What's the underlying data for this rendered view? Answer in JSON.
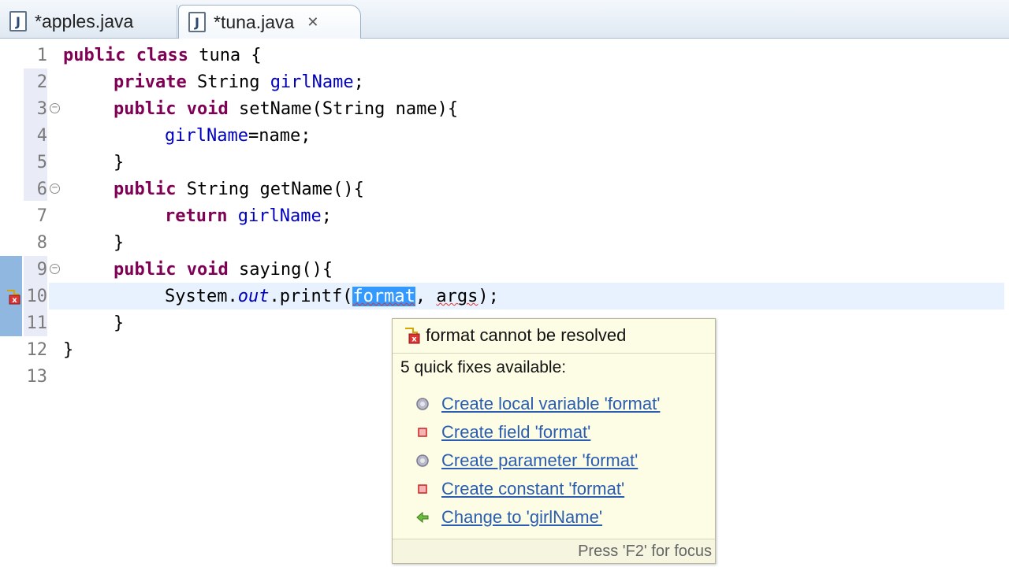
{
  "tabs": [
    {
      "label": "*apples.java",
      "icon": "java-file-icon",
      "active": false
    },
    {
      "label": "*tuna.java",
      "icon": "java-file-icon",
      "active": true,
      "close": "✕"
    }
  ],
  "editor": {
    "line_numbers": [
      "1",
      "2",
      "3",
      "4",
      "5",
      "6",
      "7",
      "8",
      "9",
      "10",
      "11",
      "12",
      "13"
    ],
    "lines": {
      "l1": {
        "kw": "public class",
        "rest": " tuna {"
      },
      "l2": {
        "kw": "private",
        "type": " String ",
        "field": "girlName",
        "end": ";"
      },
      "l3": {
        "kw": "public void",
        "rest": " setName(String name){"
      },
      "l4": {
        "field": "girlName",
        "rest": "=name;"
      },
      "l5": {
        "rest": "}"
      },
      "l6": {
        "kw": "public",
        "rest": " String getName(){"
      },
      "l7": {
        "kw": "return",
        "sp": " ",
        "field": "girlName",
        "end": ";"
      },
      "l8": {
        "rest": "}"
      },
      "l9": {
        "kw": "public void",
        "rest": " saying(){"
      },
      "l10": {
        "pre": "System.",
        "static": "out",
        "mid": ".printf(",
        "sel": "format",
        "comma": ", ",
        "err": "args",
        "end": ");"
      },
      "l11": {
        "rest": "}"
      },
      "l12": {
        "rest": "}"
      }
    },
    "error_marker_icon": "error-marker-icon"
  },
  "quickfix": {
    "title": "format cannot be resolved",
    "available": "5 quick fixes available:",
    "fixes": [
      {
        "label": "Create local variable 'format'",
        "icon": "local-variable-icon"
      },
      {
        "label": "Create field 'format'",
        "icon": "field-icon"
      },
      {
        "label": "Create parameter 'format'",
        "icon": "parameter-icon"
      },
      {
        "label": "Create constant 'format'",
        "icon": "constant-icon"
      },
      {
        "label": "Change to 'girlName'",
        "icon": "change-arrow-icon"
      }
    ],
    "footer": "Press 'F2' for focus"
  },
  "colors": {
    "keyword": "#7f0055",
    "field": "#0000c0",
    "selection": "#3399ff",
    "link": "#2a5db0",
    "popup_bg": "#fdfde6"
  }
}
